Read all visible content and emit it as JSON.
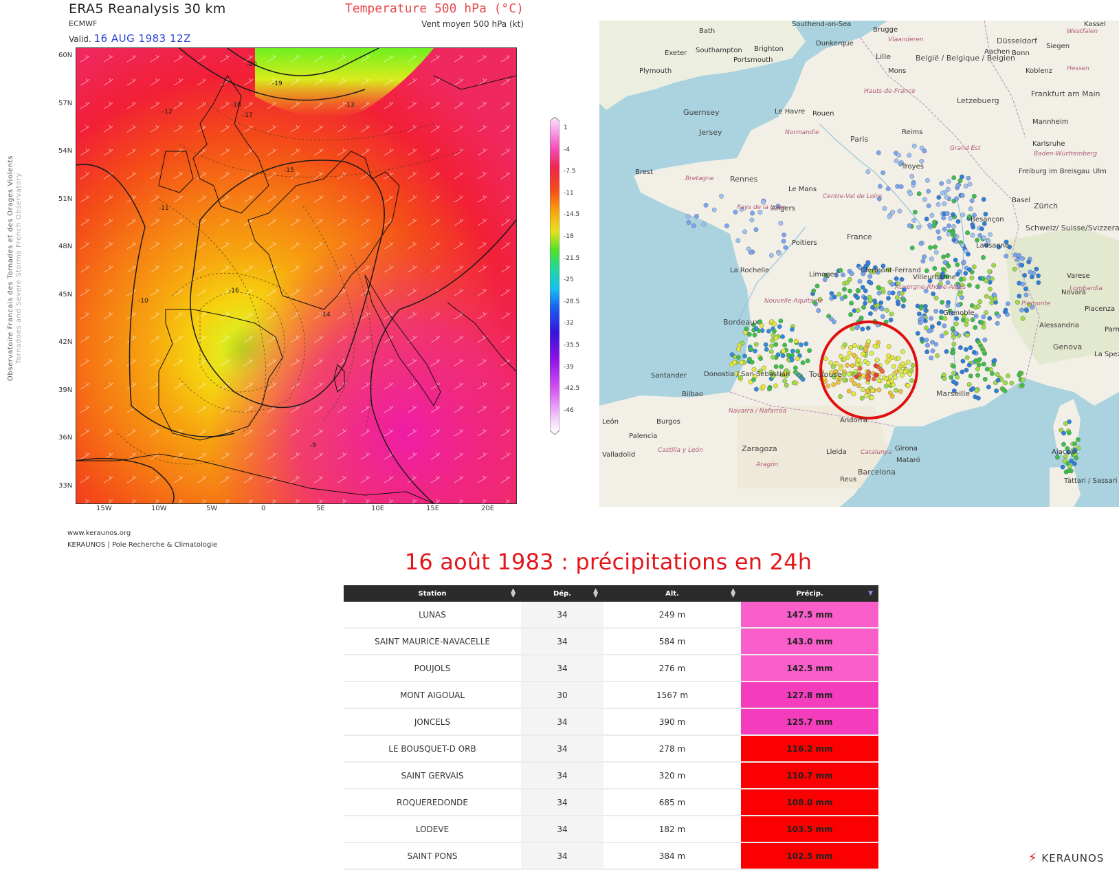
{
  "era5": {
    "title": "ERA5 Reanalysis 30 km",
    "source": "ECMWF",
    "valid_label": "Valid.",
    "valid_date": "16 AUG 1983 12Z",
    "field": "Temperature 500 hPa (°C)",
    "wind": "Vent moyen 500 hPa (kt)",
    "side_line1": "Observatoire Francais des Tornades et des Orages Violents",
    "side_line2": "Tornadoes and Severe Storms French Observatory",
    "lat_labels": [
      "60N",
      "57N",
      "54N",
      "51N",
      "48N",
      "45N",
      "42N",
      "39N",
      "36N",
      "33N"
    ],
    "lon_labels": [
      "15W",
      "10W",
      "5W",
      "0",
      "5E",
      "10E",
      "15E",
      "20E"
    ],
    "colorbar_ticks": [
      "1",
      "-4",
      "-7.5",
      "-11",
      "-14.5",
      "-18",
      "-21.5",
      "-25",
      "-28.5",
      "-32",
      "-35.5",
      "-39",
      "-42.5",
      "-46"
    ],
    "footer_url": "www.keraunos.org",
    "footer_org": "KERAUNOS | Pole Recherche & Climatologie",
    "contour_labels": [
      "-20",
      "-19",
      "-18",
      "-17",
      "-16",
      "-15",
      "-14",
      "-13",
      "-12",
      "-11",
      "-10",
      "-9"
    ]
  },
  "map_labels": {
    "cities": [
      "Bath",
      "Southend-on-Sea",
      "Brugge",
      "Düsseldorf",
      "Kassel",
      "Exeter",
      "Southampton",
      "Brighton",
      "Dunkerque",
      "Lille",
      "Aachen",
      "Bonn",
      "Siegen",
      "Plymouth",
      "Portsmouth",
      "Mons",
      "Koblenz",
      "Frankfurt am Main",
      "Le Havre",
      "Rouen",
      "Reims",
      "Mannheim",
      "Guernsey",
      "Jersey",
      "Paris",
      "Karlsruhe",
      "Brest",
      "Rennes",
      "Le Mans",
      "Troyes",
      "Freiburg im Breisgau",
      "Ulm",
      "Angers",
      "Zürich",
      "Basel",
      "Poitiers",
      "Besançon",
      "Lausanne",
      "La Rochelle",
      "Limoges",
      "Clermont-Ferrand",
      "Villeurbanne",
      "Varese",
      "Bordeaux",
      "Grenoble",
      "Novara",
      "Piacenza",
      "Alessandria",
      "Genova",
      "Parma",
      "Toulouse",
      "Marseille",
      "La Spezia",
      "Santander",
      "Donostia / San Sebastián",
      "Bilbao",
      "Andorra",
      "León",
      "Burgos",
      "Palencia",
      "Valladolid",
      "Zaragoza",
      "Lleida",
      "Girona",
      "Mataró",
      "Barcelona",
      "Reus",
      "Ajaccio",
      "Tàttari / Sassari"
    ],
    "regions": [
      "Vlaanderen",
      "Westfalen",
      "Hessen",
      "Hauts-de-France",
      "Normandie",
      "Bretagne",
      "Grand Est",
      "Pays de la Loire",
      "Centre-Val de Loire",
      "Baden-Württemberg",
      "Nouvelle-Aquitaine",
      "Auvergne-Rhône-Alpes",
      "Lombardia",
      "Piemonte",
      "Navarra / Nafarroa",
      "Castilla y León",
      "Catalunya",
      "Aragón"
    ],
    "countries": [
      "België / Belgique / Belgien",
      "Letzebuerg",
      "France",
      "Schweiz/ Suisse/Svizzera/ Svizra"
    ]
  },
  "table": {
    "title": "16 août 1983 : précipitations en 24h",
    "headers": [
      "Station",
      "Dép.",
      "Alt.",
      "Précip."
    ],
    "rows": [
      {
        "station": "LUNAS",
        "dep": "34",
        "alt": "249 m",
        "precip": "147.5 mm",
        "color": "#f95ecb"
      },
      {
        "station": "SAINT MAURICE-NAVACELLE",
        "dep": "34",
        "alt": "584 m",
        "precip": "143.0 mm",
        "color": "#f95ecb"
      },
      {
        "station": "POUJOLS",
        "dep": "34",
        "alt": "276 m",
        "precip": "142.5 mm",
        "color": "#f95ecb"
      },
      {
        "station": "MONT AIGOUAL",
        "dep": "30",
        "alt": "1567 m",
        "precip": "127.8 mm",
        "color": "#f43dbd"
      },
      {
        "station": "JONCELS",
        "dep": "34",
        "alt": "390 m",
        "precip": "125.7 mm",
        "color": "#f43dbd"
      },
      {
        "station": "LE BOUSQUET-D ORB",
        "dep": "34",
        "alt": "278 m",
        "precip": "116.2 mm",
        "color": "#fb0000"
      },
      {
        "station": "SAINT GERVAIS",
        "dep": "34",
        "alt": "320 m",
        "precip": "110.7 mm",
        "color": "#fb0000"
      },
      {
        "station": "ROQUEREDONDE",
        "dep": "34",
        "alt": "685 m",
        "precip": "108.0 mm",
        "color": "#fb0000"
      },
      {
        "station": "LODEVE",
        "dep": "34",
        "alt": "182 m",
        "precip": "103.5 mm",
        "color": "#fb0000"
      },
      {
        "station": "SAINT PONS",
        "dep": "34",
        "alt": "384 m",
        "precip": "102.5 mm",
        "color": "#fb0000"
      }
    ]
  },
  "logo": "KERAUNOS"
}
